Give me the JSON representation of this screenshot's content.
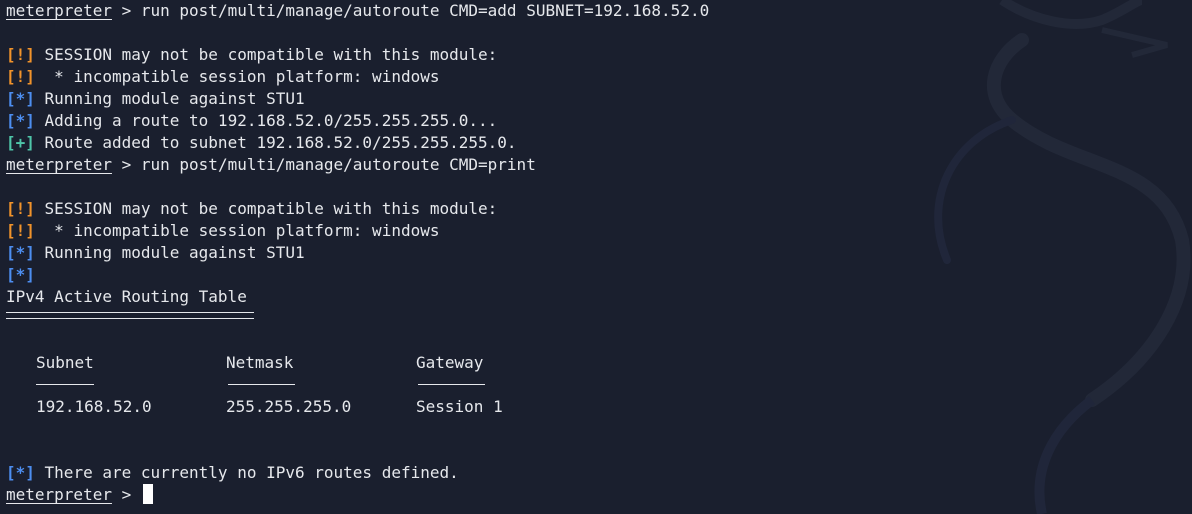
{
  "prompt": "meterpreter",
  "prompt_sep": " > ",
  "tags": {
    "warn": "[!]",
    "info": "[*]",
    "good": "[+]"
  },
  "commands": {
    "cmd1": "run post/multi/manage/autoroute CMD=add SUBNET=192.168.52.0",
    "cmd2": "run post/multi/manage/autoroute CMD=print"
  },
  "messages": {
    "compat": " SESSION may not be compatible with this module:",
    "platform": "  * incompatible session platform: windows",
    "running": " Running module against STU1",
    "adding": " Adding a route to 192.168.52.0/255.255.255.0...",
    "added": " Route added to subnet 192.168.52.0/255.255.255.0.",
    "no_ipv6": " There are currently no IPv6 routes defined."
  },
  "routing_table": {
    "title": "IPv4 Active Routing Table",
    "headers": [
      "Subnet",
      "Netmask",
      "Gateway"
    ],
    "rows": [
      [
        "192.168.52.0",
        "255.255.255.0",
        "Session 1"
      ]
    ]
  },
  "colors": {
    "background": "#1a1f2e",
    "text": "#e6e8ec",
    "warn": "#f1932b",
    "info": "#4d8ef0",
    "good": "#4fc6a9"
  }
}
